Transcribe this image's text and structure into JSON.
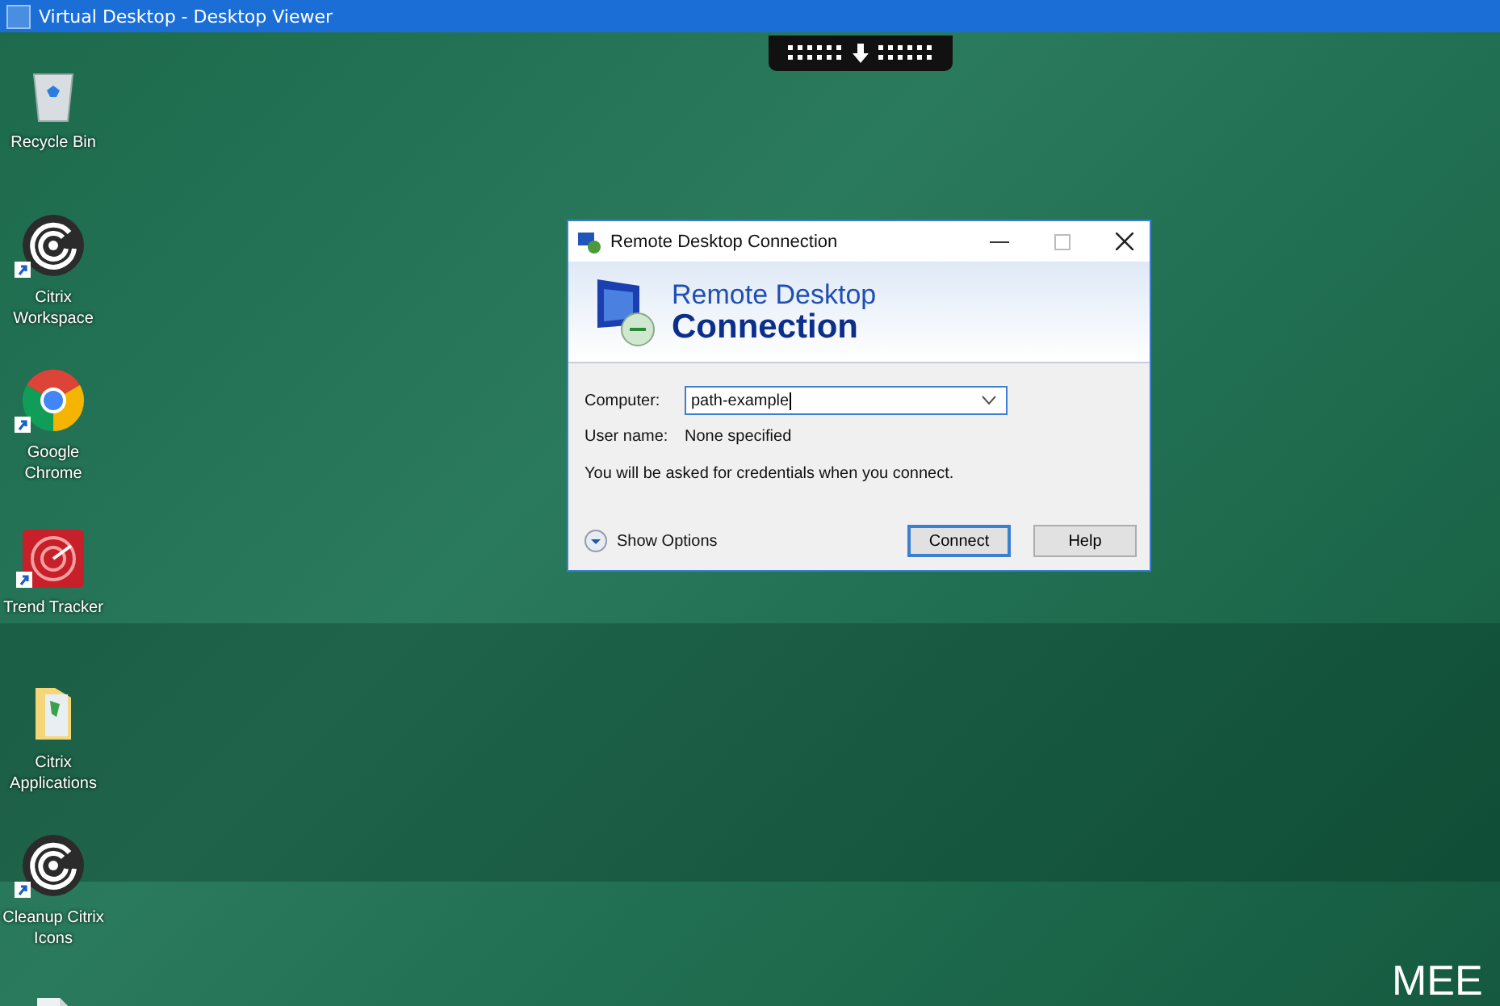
{
  "window": {
    "title": "Virtual Desktop - Desktop Viewer"
  },
  "desktop_icons": [
    {
      "kind": "recycle",
      "label": "Recycle Bin",
      "shortcut": false
    },
    {
      "kind": "citrix",
      "label": "Citrix Workspace",
      "shortcut": true
    },
    {
      "kind": "chrome",
      "label": "Google Chrome",
      "shortcut": true
    },
    {
      "kind": "radar",
      "label": "Trend Tracker",
      "shortcut": true
    },
    {
      "kind": "folder",
      "label": "Citrix Applications",
      "shortcut": false
    },
    {
      "kind": "citrix",
      "label": "Cleanup Citrix Icons",
      "shortcut": true
    },
    {
      "kind": "document"
    }
  ],
  "wallpaper_text": "MEE",
  "dialog": {
    "title": "Remote Desktop Connection",
    "banner_line_1": "Remote Desktop",
    "banner_line_2": "Connection",
    "computer_label": "Computer:",
    "computer_value": "path-example",
    "user_label": "User name:",
    "user_value": "None specified",
    "note": "You will be asked for credentials when you connect.",
    "show_options": "Show Options",
    "buttons": [
      {
        "label": "Connect",
        "default": true
      },
      {
        "label": "Help",
        "default": false
      }
    ]
  }
}
